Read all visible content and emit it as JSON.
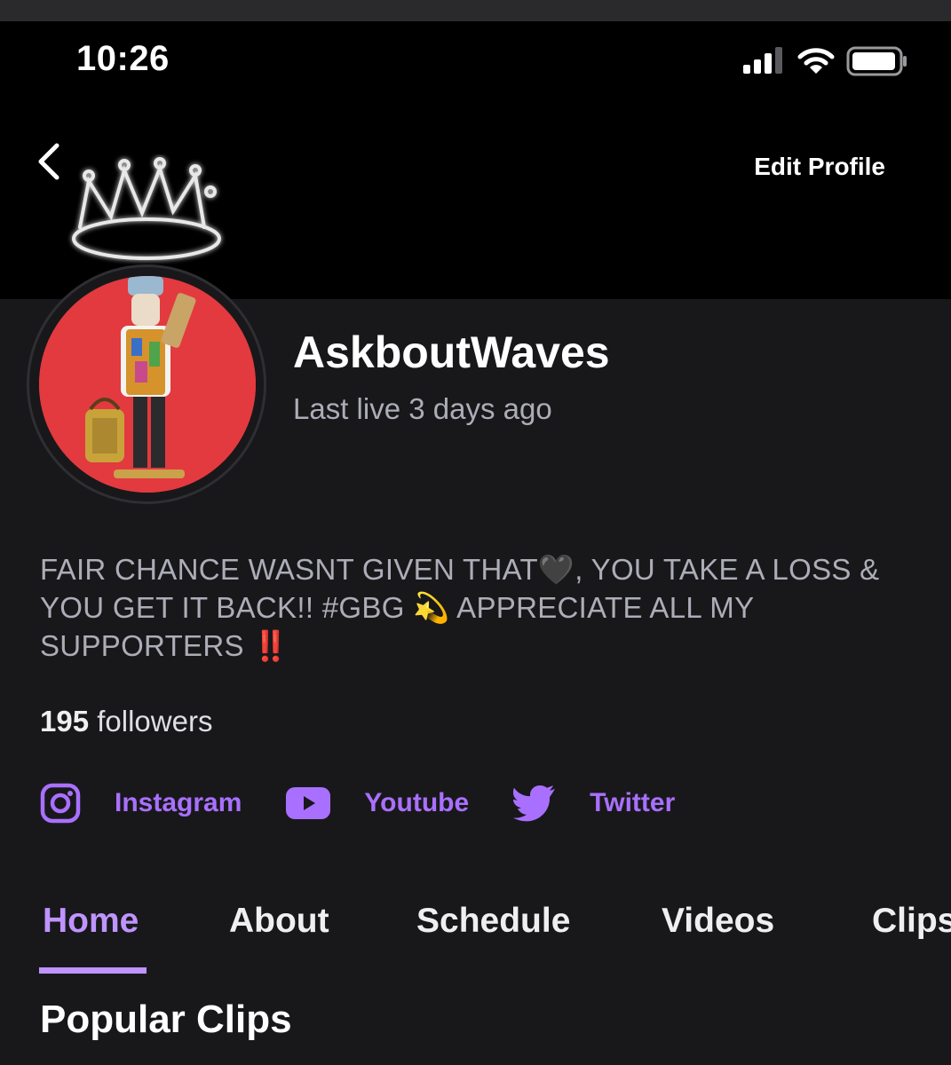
{
  "status_bar": {
    "time": "10:26"
  },
  "header": {
    "edit_profile_label": "Edit Profile"
  },
  "profile": {
    "username": "AskboutWaves",
    "last_live": "Last live 3 days ago",
    "bio": "FAIR CHANCE WASNT GIVEN THAT🖤, YOU TAKE A LOSS & YOU GET IT BACK!! #GBG 💫 APPRECIATE ALL MY SUPPORTERS ‼️",
    "followers_count": "195",
    "followers_label": "followers"
  },
  "socials": [
    {
      "label": "Instagram",
      "icon": "instagram-icon"
    },
    {
      "label": "Youtube",
      "icon": "youtube-icon"
    },
    {
      "label": "Twitter",
      "icon": "twitter-icon"
    }
  ],
  "tabs": [
    {
      "label": "Home",
      "active": true
    },
    {
      "label": "About"
    },
    {
      "label": "Schedule"
    },
    {
      "label": "Videos"
    },
    {
      "label": "Clips"
    }
  ],
  "section": {
    "title": "Popular Clips"
  },
  "colors": {
    "accent": "#bf94ff",
    "link": "#a970ff",
    "background": "#18181b",
    "header": "#000000",
    "avatar_bg": "#e23a3f"
  }
}
